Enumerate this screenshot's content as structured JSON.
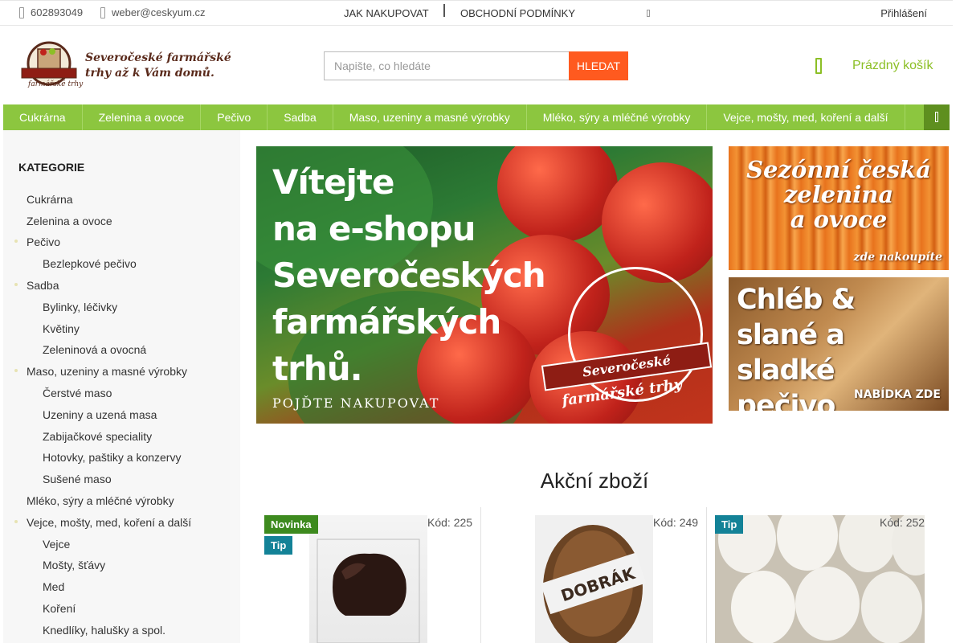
{
  "topbar": {
    "phone": "602893049",
    "email": "weber@ceskyum.cz",
    "links": [
      "JAK NAKUPOVAT",
      "OBCHODNÍ PODMÍNKY"
    ],
    "login": "Přihlášení"
  },
  "header": {
    "logo_text_line1": "Severočeské farmářské",
    "logo_text_line2": "trhy až k Vám domů.",
    "logo_seal_text": "Severočeské farmářské trhy",
    "search_placeholder": "Napište, co hledáte",
    "search_button": "HLEDAT",
    "cart_label": "Prázdný košík"
  },
  "nav": {
    "items": [
      "Cukrárna",
      "Zelenina a ovoce",
      "Pečivo",
      "Sadba",
      "Maso, uzeniny a masné výrobky",
      "Mléko, sýry a mléčné výrobky",
      "Vejce, mošty, med, koření a další"
    ]
  },
  "sidebar": {
    "title": "KATEGORIE",
    "items": [
      {
        "label": "Cukrárna"
      },
      {
        "label": "Zelenina a ovoce"
      },
      {
        "label": "Pečivo"
      },
      {
        "label": "Bezlepkové pečivo"
      },
      {
        "label": "Sadba"
      },
      {
        "label": "Bylinky, léčivky"
      },
      {
        "label": "Květiny"
      },
      {
        "label": "Zeleninová a ovocná"
      },
      {
        "label": "Maso, uzeniny a masné výrobky"
      },
      {
        "label": "Čerstvé maso"
      },
      {
        "label": "Uzeniny a uzená masa"
      },
      {
        "label": "Zabijačkové speciality"
      },
      {
        "label": "Hotovky, paštiky a konzervy"
      },
      {
        "label": "Sušené maso"
      },
      {
        "label": "Mléko, sýry a mléčné výrobky"
      },
      {
        "label": "Vejce, mošty, med, koření a další"
      },
      {
        "label": "Vejce"
      },
      {
        "label": "Mošty, šťávy"
      },
      {
        "label": "Med"
      },
      {
        "label": "Koření"
      },
      {
        "label": "Knedlíky, halušky a spol."
      }
    ]
  },
  "banners": {
    "main_lines": [
      "Vítejte",
      "na e-shopu",
      "Severočeských",
      "farmářských",
      "trhů."
    ],
    "main_cta": "POJĎTE NAKUPOVAT",
    "main_seal_ribbon": "Severočeské",
    "main_seal_under": "farmářské trhy",
    "veg_lines": [
      "Sezónní česká",
      "zelenina",
      "a ovoce"
    ],
    "veg_sub": "zde nakoupíte",
    "bread_lines": [
      "Chléb &",
      "slané a sladké",
      "pečivo"
    ],
    "bread_sub": "NABÍDKA ZDE"
  },
  "products": {
    "title": "Akční zboží",
    "items": [
      {
        "code": "Kód: 225",
        "badges": [
          "Novinka",
          "Tip"
        ]
      },
      {
        "code": "Kód: 249",
        "badges": [],
        "label_on_bread": "DOBRÁK"
      },
      {
        "code": "Kód: 252",
        "badges": [
          "Tip"
        ]
      }
    ]
  },
  "colors": {
    "nav_green": "#8cc63f",
    "search_orange": "#ff5a1f",
    "badge_new": "#3d8a1e",
    "badge_tip": "#138297"
  }
}
